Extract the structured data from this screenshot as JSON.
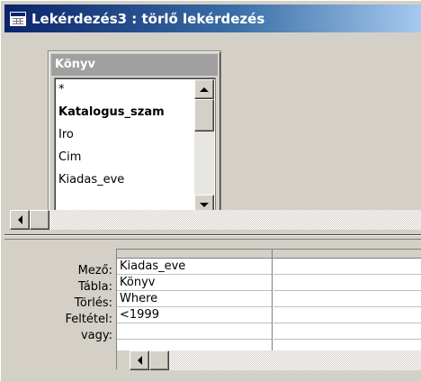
{
  "window": {
    "title": "Lekérdezés3 : törlő lekérdezés"
  },
  "table_box": {
    "title": "Könyv",
    "fields": [
      {
        "label": "*",
        "bold": false
      },
      {
        "label": "Katalogus_szam",
        "bold": true
      },
      {
        "label": "Iro",
        "bold": false
      },
      {
        "label": "Cim",
        "bold": false
      },
      {
        "label": "Kiadas_eve",
        "bold": false
      }
    ]
  },
  "grid": {
    "row_labels": {
      "field": "Mező:",
      "table": "Tábla:",
      "delete": "Törlés:",
      "criteria": "Feltétel:",
      "or": "vagy:"
    },
    "columns": [
      {
        "field": "Kiadas_eve",
        "table": "Könyv",
        "delete": "Where",
        "criteria": "<1999",
        "or": ""
      },
      {
        "field": "",
        "table": "",
        "delete": "",
        "criteria": "",
        "or": ""
      }
    ]
  },
  "icons": {
    "window_icon": "query-window-icon",
    "scroll_up": "scroll-up-arrow-icon",
    "scroll_down": "scroll-down-arrow-icon",
    "scroll_left": "scroll-left-arrow-icon"
  },
  "colors": {
    "title_bar_start": "#0a246a",
    "title_bar_end": "#a6caf0",
    "table_title_bg": "#a0a0a0",
    "face": "#d4d0c8"
  }
}
